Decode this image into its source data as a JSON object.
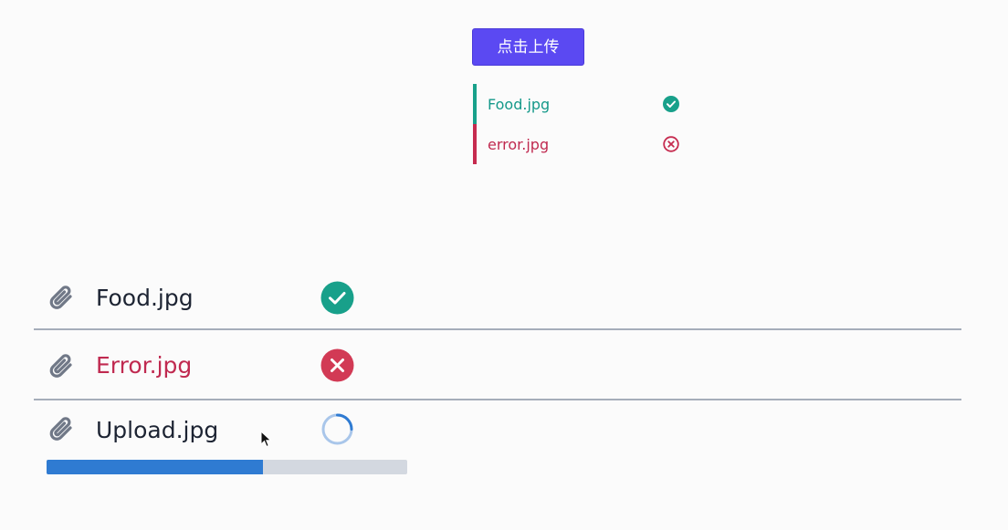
{
  "upload_button": {
    "label": "点击上传"
  },
  "small_list": {
    "items": [
      {
        "name": "Food.jpg",
        "status": "success",
        "icon": "check-circle-icon"
      },
      {
        "name": "error.jpg",
        "status": "error",
        "icon": "x-circle-outline-icon"
      }
    ]
  },
  "file_list": {
    "items": [
      {
        "name": "Food.jpg",
        "status": "success",
        "icon": "check-circle-icon"
      },
      {
        "name": "Error.jpg",
        "status": "error",
        "icon": "x-circle-icon"
      },
      {
        "name": "Upload.jpg",
        "status": "uploading",
        "icon": "spinner-icon",
        "progress": 0.6
      }
    ]
  },
  "colors": {
    "accent": "#5b49f2",
    "success": "#18a08a",
    "error": "#c62b4f",
    "progress": "#2f7bd2",
    "track": "#d3d8e0"
  }
}
